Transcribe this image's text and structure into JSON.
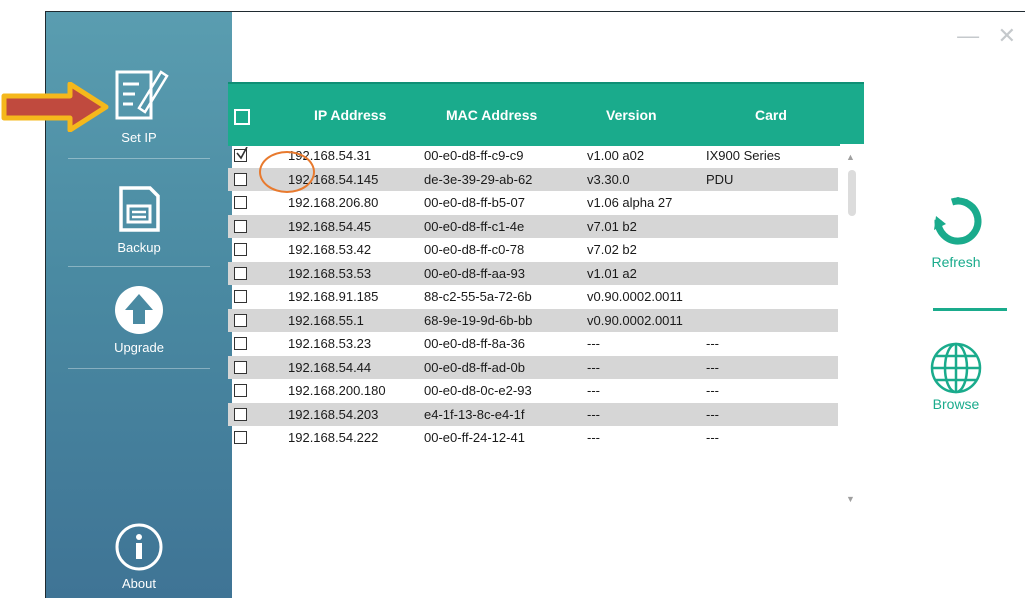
{
  "window": {
    "minimize_icon": "minimize-icon",
    "close_icon": "close-icon"
  },
  "sidebar": {
    "items": [
      {
        "label": "Set IP",
        "icon": "edit-icon"
      },
      {
        "label": "Backup",
        "icon": "save-icon"
      },
      {
        "label": "Upgrade",
        "icon": "upload-icon"
      },
      {
        "label": "About",
        "icon": "info-icon"
      }
    ]
  },
  "table": {
    "columns": [
      "IP Address",
      "MAC Address",
      "Version",
      "Card"
    ],
    "rows": [
      {
        "ip": "192.168.54.31",
        "mac": "00-e0-d8-ff-c9-c9",
        "version": "v1.00 a02",
        "card": "IX900 Series",
        "checked": true
      },
      {
        "ip": "192.168.54.145",
        "mac": "de-3e-39-29-ab-62",
        "version": "v3.30.0",
        "card": "PDU",
        "checked": false
      },
      {
        "ip": "192.168.206.80",
        "mac": "00-e0-d8-ff-b5-07",
        "version": "v1.06 alpha 27",
        "card": "",
        "checked": false
      },
      {
        "ip": "192.168.54.45",
        "mac": "00-e0-d8-ff-c1-4e",
        "version": "v7.01 b2",
        "card": "",
        "checked": false
      },
      {
        "ip": "192.168.53.42",
        "mac": "00-e0-d8-ff-c0-78",
        "version": "v7.02 b2",
        "card": "",
        "checked": false
      },
      {
        "ip": "192.168.53.53",
        "mac": "00-e0-d8-ff-aa-93",
        "version": "v1.01 a2",
        "card": "",
        "checked": false
      },
      {
        "ip": "192.168.91.185",
        "mac": "88-c2-55-5a-72-6b",
        "version": "v0.90.0002.0011",
        "card": "",
        "checked": false
      },
      {
        "ip": "192.168.55.1",
        "mac": "68-9e-19-9d-6b-bb",
        "version": "v0.90.0002.0011",
        "card": "",
        "checked": false
      },
      {
        "ip": "192.168.53.23",
        "mac": "00-e0-d8-ff-8a-36",
        "version": "---",
        "card": "---",
        "checked": false
      },
      {
        "ip": "192.168.54.44",
        "mac": "00-e0-d8-ff-ad-0b",
        "version": "---",
        "card": "---",
        "checked": false
      },
      {
        "ip": "192.168.200.180",
        "mac": "00-e0-d8-0c-e2-93",
        "version": "---",
        "card": "---",
        "checked": false
      },
      {
        "ip": "192.168.54.203",
        "mac": "e4-1f-13-8c-e4-1f",
        "version": "---",
        "card": "---",
        "checked": false
      },
      {
        "ip": "192.168.54.222",
        "mac": "00-e0-ff-24-12-41",
        "version": "---",
        "card": "---",
        "checked": false
      }
    ]
  },
  "right_panel": {
    "refresh_label": "Refresh",
    "browse_label": "Browse"
  },
  "colors": {
    "accent": "#1aab8c",
    "sidebar": "#4a8aa2",
    "highlight": "#e87a2e",
    "arrow": "#f5b81c"
  }
}
